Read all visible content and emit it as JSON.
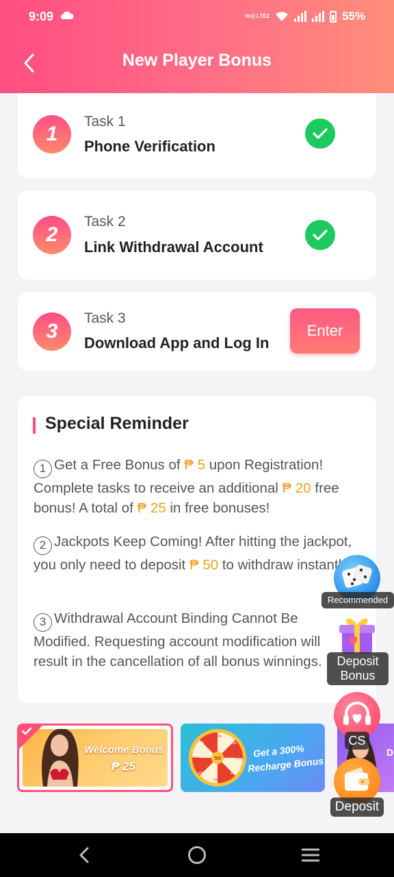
{
  "status_bar": {
    "time": "9:09",
    "volte": "Vo)) LTE2",
    "battery_percent": "55%",
    "cloud_icon": "cloud-icon",
    "wifi_icon": "wifi-icon",
    "signal_icon": "signal-icon",
    "battery_icon": "battery-icon"
  },
  "header": {
    "title": "New Player Bonus",
    "back_icon": "chevron-left-icon"
  },
  "tasks": [
    {
      "number": "1",
      "label": "Task 1",
      "title": "Phone Verification",
      "status": "completed"
    },
    {
      "number": "2",
      "label": "Task 2",
      "title": "Link Withdrawal Account",
      "status": "completed"
    },
    {
      "number": "3",
      "label": "Task 3",
      "title": "Download App and Log In",
      "status": "pending",
      "button_label": "Enter"
    }
  ],
  "reminder": {
    "title": "Special Reminder",
    "items": [
      {
        "num": "1",
        "t1": "Get a Free Bonus of ",
        "a1": "₱ 5",
        "t2": " upon Registration! Complete tasks to receive an additional ",
        "a2": "₱ 20",
        "t3": " free bonus! A total of ",
        "a3": "₱ 25",
        "t4": " in free bonuses!"
      },
      {
        "num": "2",
        "t1": "Jackpots Keep Coming! After hitting the jackpot, you only need to deposit ",
        "a1": "₱ 50",
        "t2": " to withdraw instantly!"
      },
      {
        "num": "3",
        "t1": "Withdrawal Account Binding Cannot Be Modified. Requesting account modification will result in the cancellation of all bonus winnings."
      }
    ]
  },
  "banners": [
    {
      "line1": "Welcome Bonus",
      "line2": "₱ 25",
      "selected": true
    },
    {
      "line1": "Get a 300%",
      "line2": "Recharge Bonus",
      "wheel_center": "50",
      "wheel_labels": [
        "300s",
        "10s",
        "150s",
        "x15",
        "250s",
        "x20",
        "200s",
        "x25"
      ]
    },
    {
      "line1": "D"
    }
  ],
  "floating_buttons": [
    {
      "label": "Recommended",
      "icon": "dice-icon"
    },
    {
      "label_line1": "Deposit",
      "label_line2": "Bonus",
      "icon": "gift-box-icon"
    },
    {
      "label": "CS",
      "icon": "headset-icon"
    },
    {
      "label": "Deposit",
      "icon": "wallet-icon"
    }
  ],
  "colors": {
    "accent": "#ff4e82",
    "amount": "#f2a020",
    "success": "#1ec95f"
  }
}
